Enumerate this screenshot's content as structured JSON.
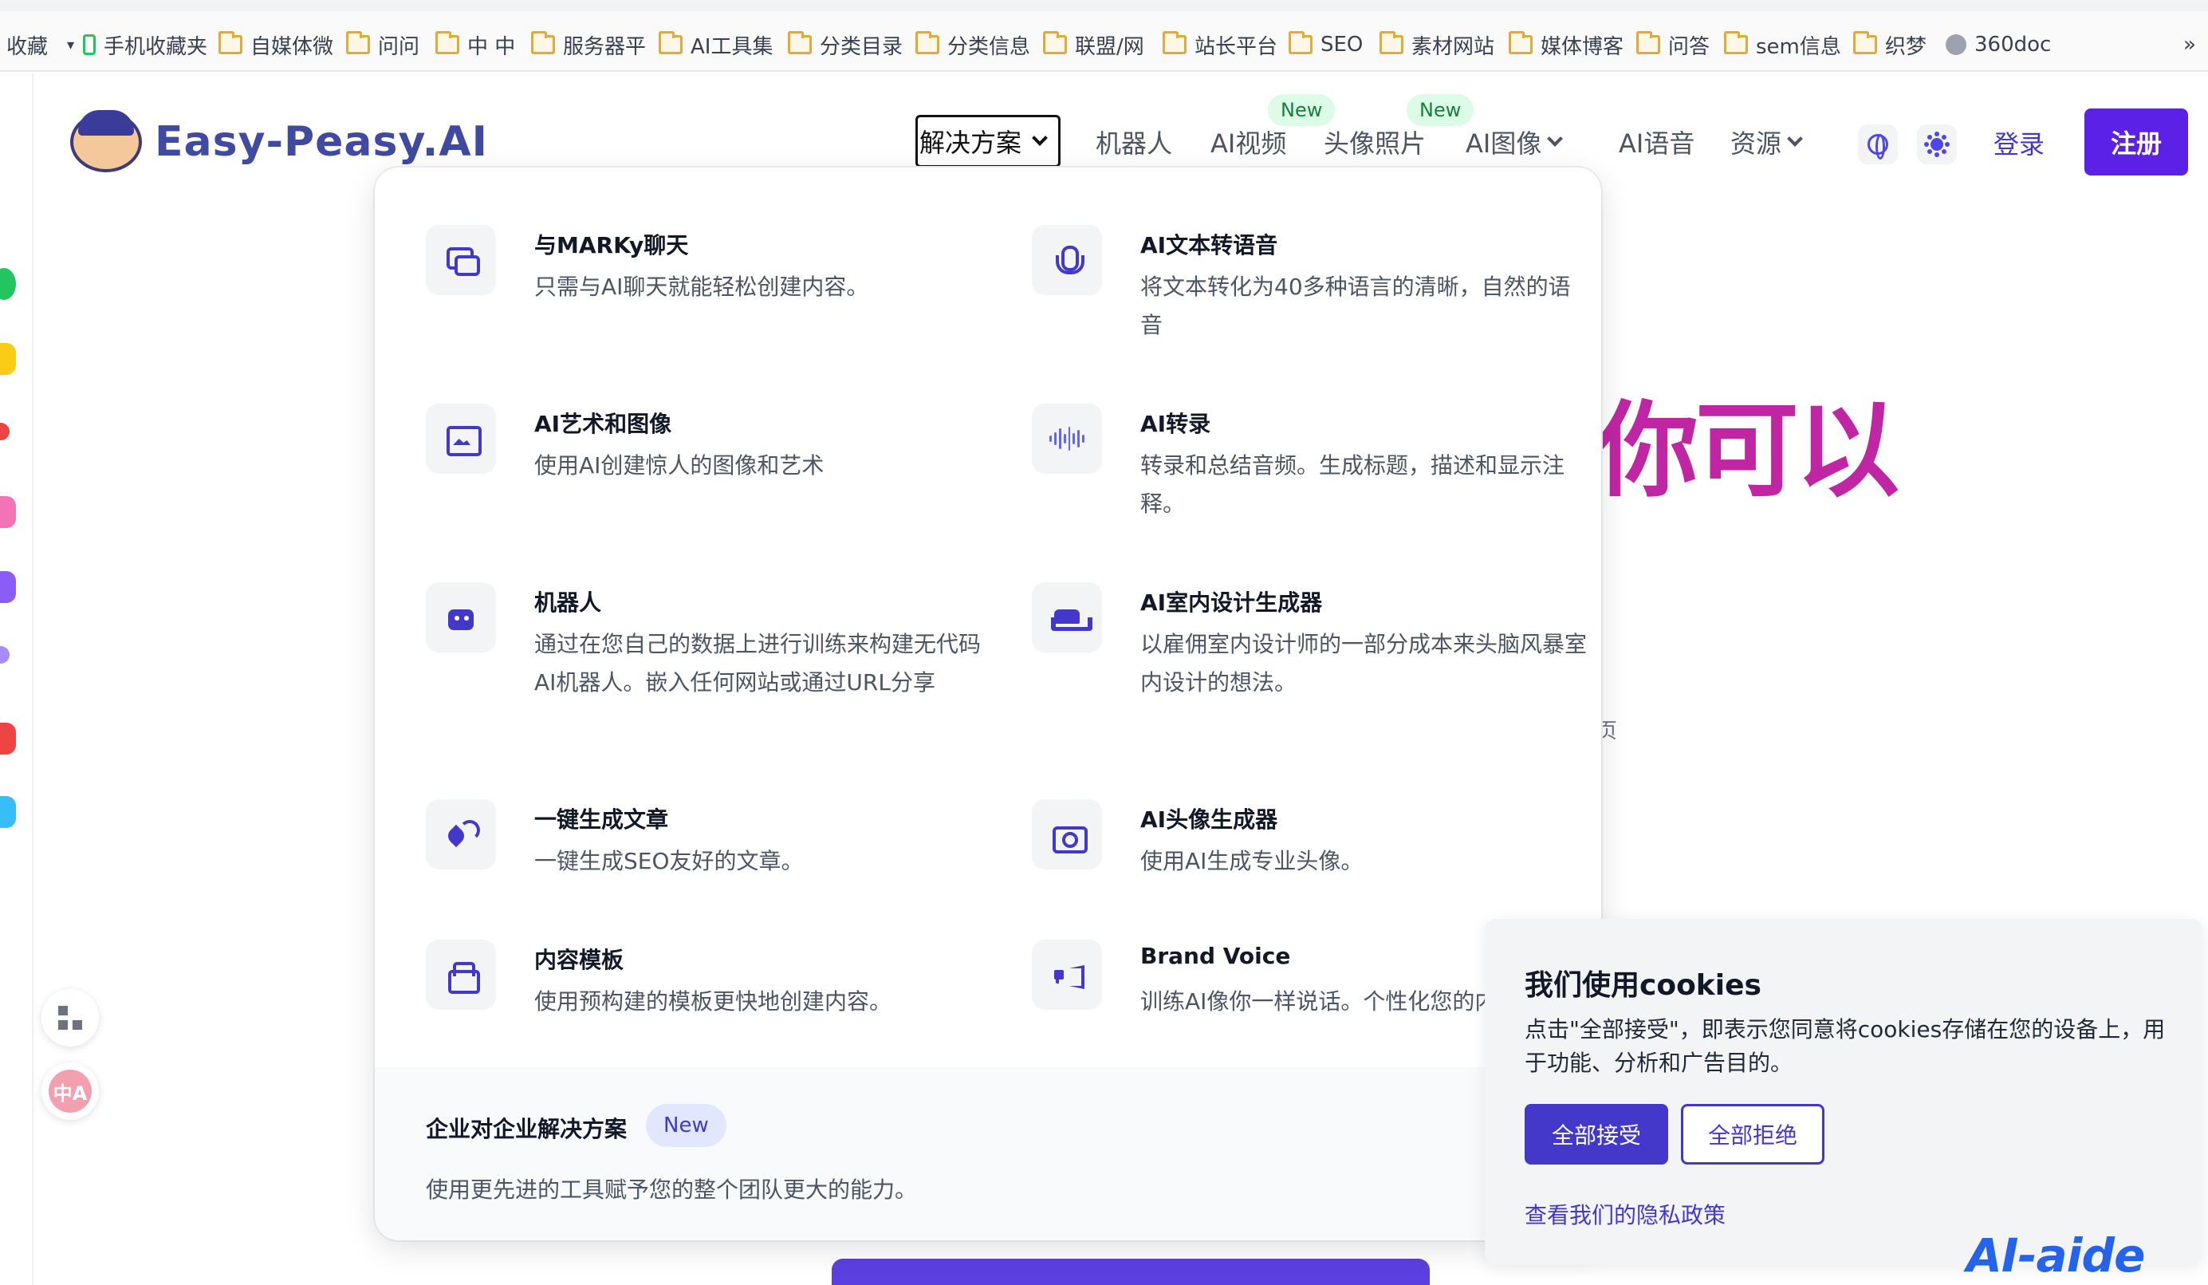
{
  "bookmarks": {
    "items": [
      {
        "label": "收藏",
        "icon": "none"
      },
      {
        "label": "手机收藏夹",
        "icon": "phone-icon"
      },
      {
        "label": "自媒体微",
        "icon": "folder-icon"
      },
      {
        "label": "问问",
        "icon": "folder-icon"
      },
      {
        "label": "中 中",
        "icon": "folder-icon"
      },
      {
        "label": "服务器平",
        "icon": "folder-icon"
      },
      {
        "label": "AI工具集",
        "icon": "folder-icon"
      },
      {
        "label": "分类目录",
        "icon": "folder-icon"
      },
      {
        "label": "分类信息",
        "icon": "folder-icon"
      },
      {
        "label": "联盟/网",
        "icon": "folder-icon"
      },
      {
        "label": "站长平台",
        "icon": "folder-icon"
      },
      {
        "label": "SEO",
        "icon": "folder-icon"
      },
      {
        "label": "素材网站",
        "icon": "folder-icon"
      },
      {
        "label": "媒体博客",
        "icon": "folder-icon"
      },
      {
        "label": "问答",
        "icon": "folder-icon"
      },
      {
        "label": "sem信息",
        "icon": "folder-icon"
      },
      {
        "label": "织梦",
        "icon": "folder-icon"
      },
      {
        "label": "360doc",
        "icon": "globe-icon"
      }
    ],
    "more": "»"
  },
  "header": {
    "logo_text": "Easy-Peasy.AI",
    "nav": {
      "solutions": "解决方案",
      "bots": "机器人",
      "video": "AI视频",
      "headshots": "头像照片",
      "image": "AI图像",
      "voice": "AI语音",
      "resources": "资源"
    },
    "new_badge": "New",
    "login": "登录",
    "signup": "注册"
  },
  "hero": {
    "fragment": "你可以",
    "small_fragment": "页"
  },
  "dropdown": {
    "items": [
      {
        "title": "与MARKy聊天",
        "desc": "只需与AI聊天就能轻松创建内容。",
        "icon": "chat-icon"
      },
      {
        "title": "AI文本转语音",
        "desc": "将文本转化为40多种语言的清晰，自然的语音",
        "icon": "microphone-icon"
      },
      {
        "title": "AI艺术和图像",
        "desc": "使用AI创建惊人的图像和艺术",
        "icon": "image-icon"
      },
      {
        "title": "AI转录",
        "desc": "转录和总结音频。生成标题，描述和显示注释。",
        "icon": "waveform-icon"
      },
      {
        "title": "机器人",
        "desc": "通过在您自己的数据上进行训练来构建无代码AI机器人。嵌入任何网站或通过URL分享",
        "icon": "robot-icon"
      },
      {
        "title": "AI室内设计生成器",
        "desc": "以雇佣室内设计师的一部分成本来头脑风暴室内设计的想法。",
        "icon": "sofa-icon"
      },
      {
        "title": "一键生成文章",
        "desc": "一键生成SEO友好的文章。",
        "icon": "pen-nib-icon"
      },
      {
        "title": "AI头像生成器",
        "desc": "使用AI生成专业头像。",
        "icon": "camera-icon"
      },
      {
        "title": "内容模板",
        "desc": "使用预构建的模板更快地创建内容。",
        "icon": "template-icon"
      },
      {
        "title": "Brand Voice",
        "desc": "训练AI像你一样说话。个性化您的内容",
        "icon": "megaphone-icon"
      }
    ],
    "footer": {
      "title": "企业对企业解决方案",
      "badge": "New",
      "desc": "使用更先进的工具赋予您的整个团队更大的能力。"
    }
  },
  "cookie": {
    "title": "我们使用cookies",
    "text": "点击\"全部接受\"，即表示您同意将cookies存储在您的设备上，用于功能、分析和广告目的。",
    "accept": "全部接受",
    "reject": "全部拒绝",
    "policy": "查看我们的隐私政策"
  },
  "watermark": "AI-aide",
  "side_tools": {
    "translate_label": "中A"
  },
  "colors": {
    "brand": "#5b21e6",
    "accent": "#4338ca",
    "hero": "#c026a4",
    "new_badge_bg": "#dcfce7"
  }
}
